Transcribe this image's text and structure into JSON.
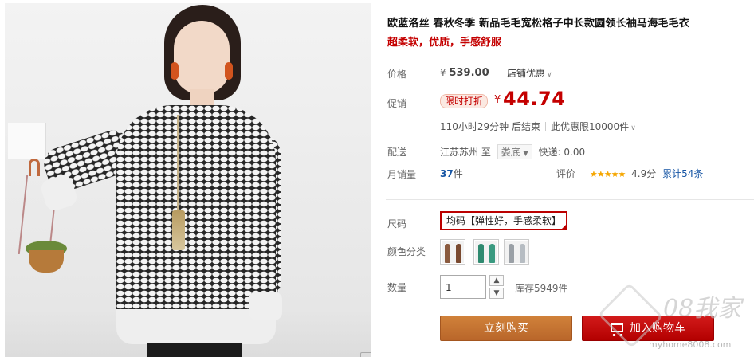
{
  "product": {
    "title": "欧蓝洛丝 春秋冬季 新品毛毛宽松格子中长款圆领长袖马海毛毛衣",
    "subtitle": "超柔软，优质，手感舒服"
  },
  "price": {
    "label": "价格",
    "currency": "¥",
    "original": "539.00",
    "shop_discount": "店铺优惠",
    "promo_label": "促销",
    "promo_badge": "限时打折",
    "promo_price": "44.74",
    "countdown": "110小时29分钟 后结束",
    "limit": "此优惠限10000件"
  },
  "shipping": {
    "label": "配送",
    "from": "江苏苏州",
    "to_word": "至",
    "dest": "娄底",
    "fee": "快递: 0.00"
  },
  "sales": {
    "label": "月销量",
    "count": "37",
    "unit": "件",
    "rating_label": "评价",
    "stars": "★★★★★",
    "score": "4.9分",
    "reviews": "累计54条"
  },
  "options": {
    "size_label": "尺码",
    "size_value": "均码【弹性好，手感柔软】",
    "color_label": "颜色分类",
    "colors": [
      "#8a5a3e",
      "#2f8a70",
      "#9aa0a6"
    ]
  },
  "quantity": {
    "label": "数量",
    "value": "1",
    "up": "▲",
    "down": "▼",
    "stock": "库存5949件"
  },
  "actions": {
    "buy_now": "立刻购买",
    "add_to_cart": "加入购物车"
  },
  "watermark": {
    "logo_text": "08我家",
    "url": "myhome8008.com"
  },
  "theme": {
    "accent_red": "#c40000",
    "buy_orange": "#c97434",
    "cart_red": "#c80f0f",
    "link_blue": "#1756a5"
  }
}
